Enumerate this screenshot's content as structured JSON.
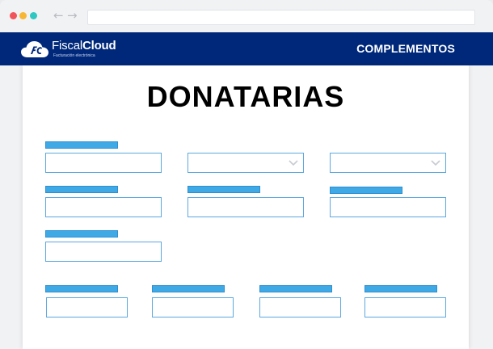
{
  "browser": {
    "back_glyph": "←",
    "forward_glyph": "→"
  },
  "header": {
    "logo": {
      "name_light": "Fiscal",
      "name_bold": "Cloud",
      "tagline": "Facturación electrónica"
    },
    "menu_item": "COMPLEMENTOS"
  },
  "page": {
    "title": "DONATARIAS"
  },
  "colors": {
    "header_bg": "#00287a",
    "label_bar": "#3fa9e6",
    "input_border": "#5da8df"
  },
  "icons": {
    "select_caret": "chevron-down-icon"
  }
}
